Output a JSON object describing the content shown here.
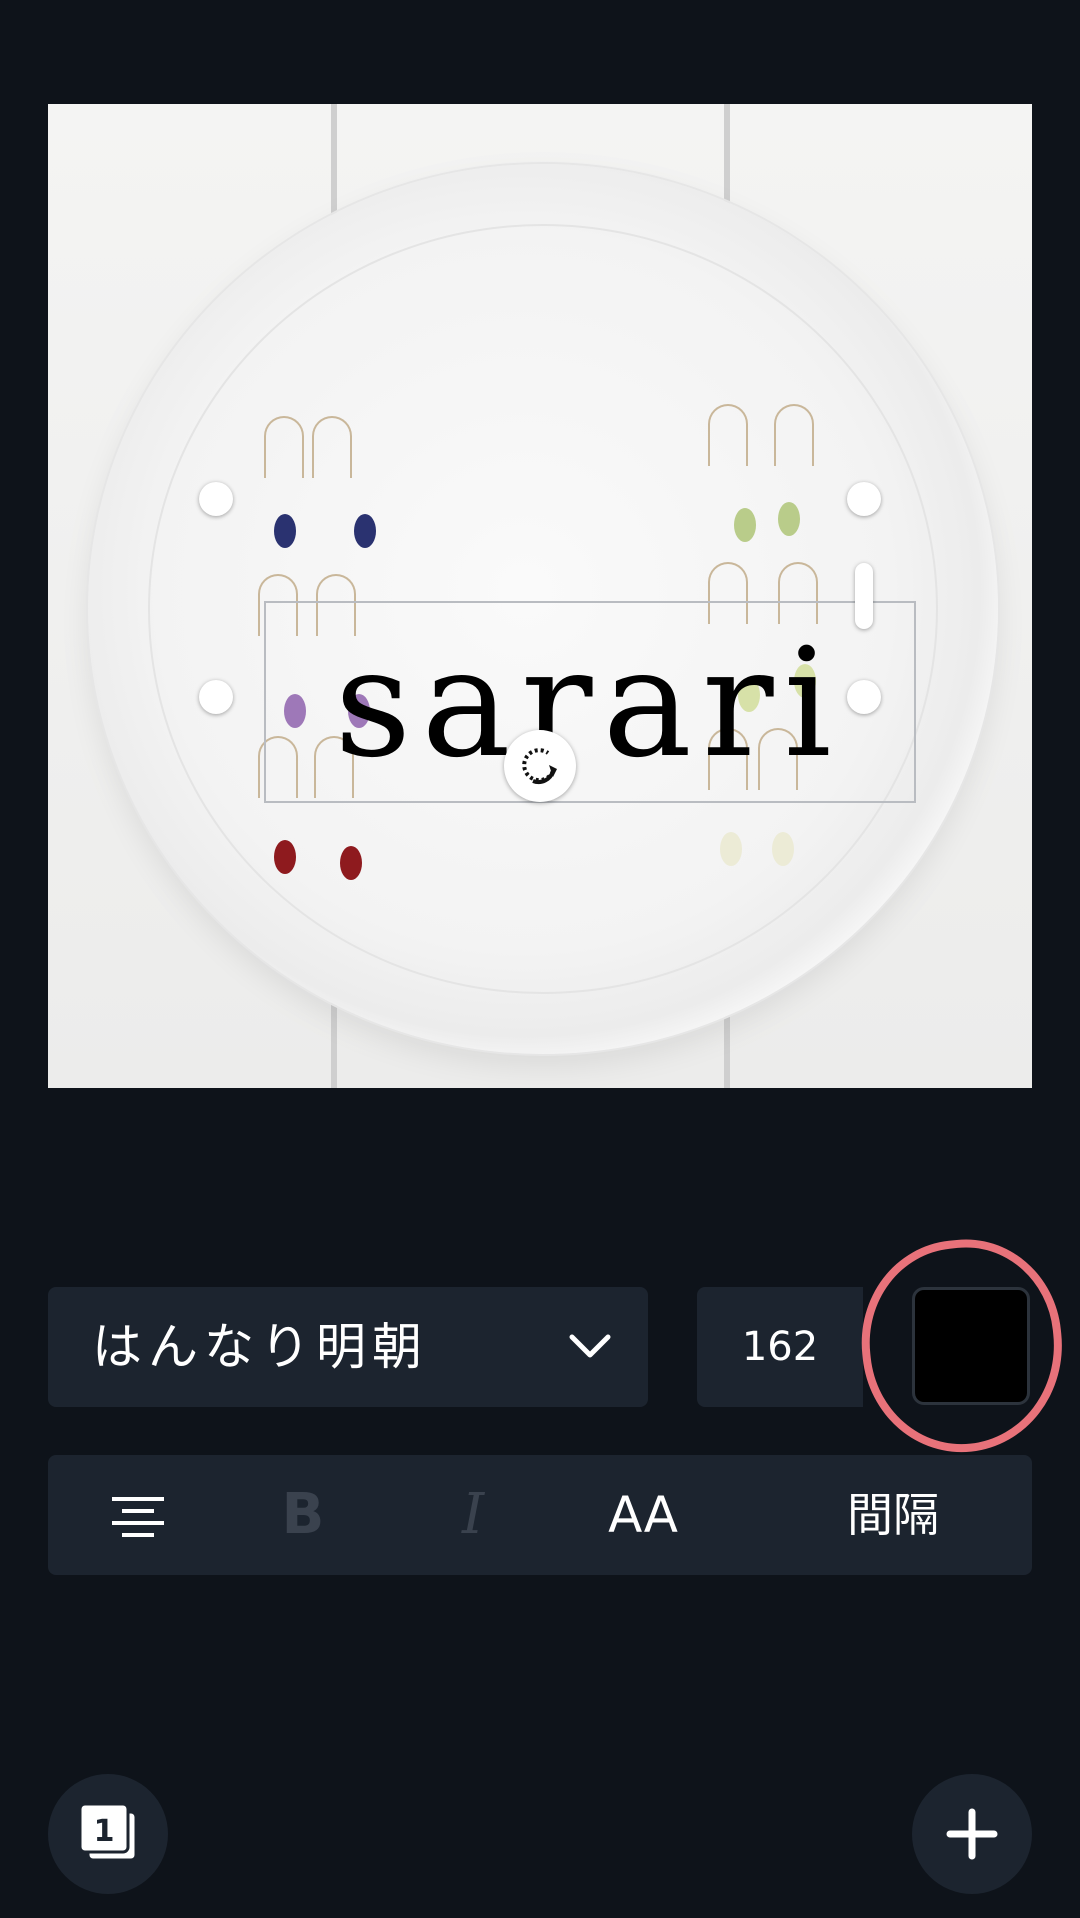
{
  "canvas": {
    "text": "sarari"
  },
  "text_toolbar": {
    "font_name": "はんなり明朝",
    "font_size": "162",
    "color": "#000000",
    "annotation_color": "#e8727a"
  },
  "format_bar": {
    "bold_label": "B",
    "italic_label": "I",
    "case_label": "AA",
    "spacing_label": "間隔"
  },
  "bottom": {
    "page_count": "1"
  }
}
